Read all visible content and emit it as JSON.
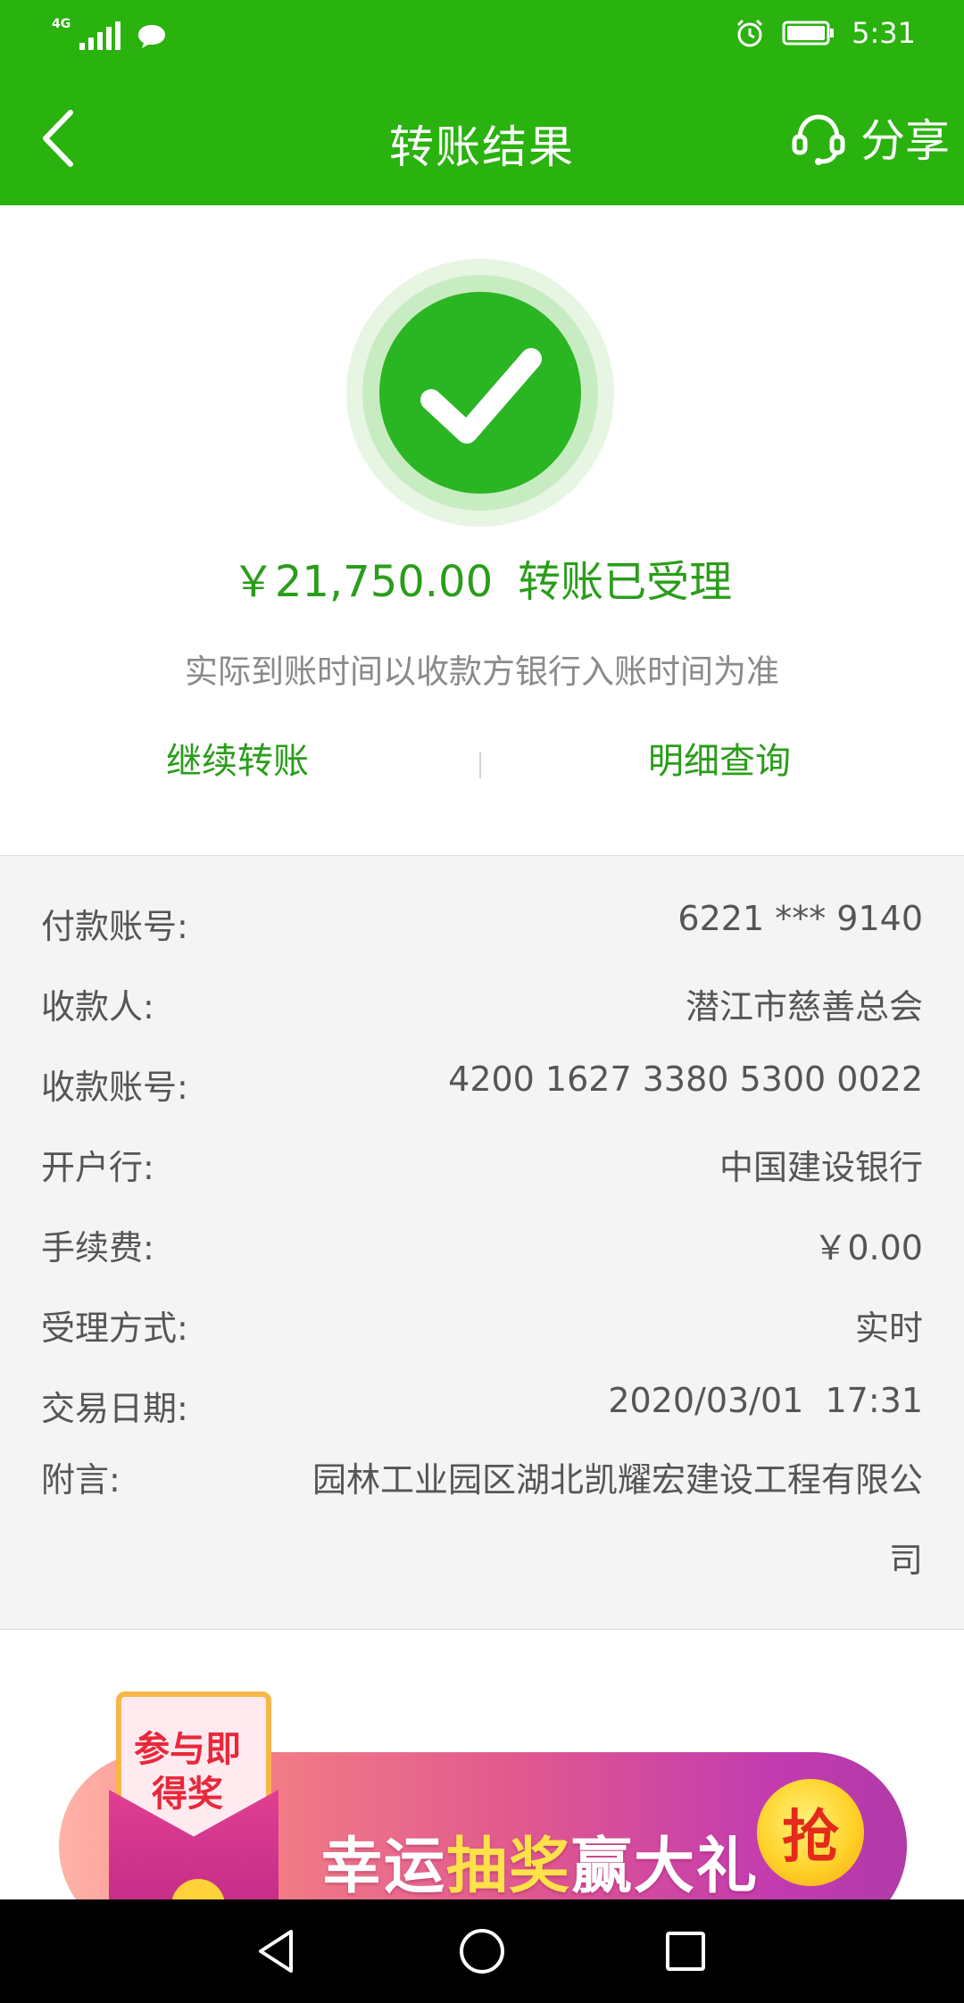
{
  "status_bar": {
    "network_label": "4G",
    "time": "5:31",
    "icons": [
      "signal-icon",
      "message-icon",
      "alarm-icon",
      "battery-icon"
    ]
  },
  "header": {
    "title": "转账结果",
    "share_label": "分享",
    "icons": [
      "back-arrow-icon",
      "customer-service-headset-icon"
    ]
  },
  "result": {
    "icon": "success-check-icon",
    "amount": "￥21,750.00",
    "status": "转账已受理",
    "note": "实际到账时间以收款方银行入账时间为准",
    "actions": {
      "continue_transfer": "继续转账",
      "detail_query": "明细查询"
    }
  },
  "details": {
    "rows": [
      {
        "label": "付款账号:",
        "value": "6221 *** 9140"
      },
      {
        "label": "收款人:",
        "value": "潜江市慈善总会"
      },
      {
        "label": "收款账号:",
        "value": "4200 1627 3380 5300 0022"
      },
      {
        "label": "开户行:",
        "value": "中国建设银行"
      },
      {
        "label": "手续费:",
        "value": "￥0.00"
      },
      {
        "label": "受理方式:",
        "value": "实时"
      },
      {
        "label": "交易日期:",
        "value": "2020/03/01  17:31"
      },
      {
        "label": "附言:",
        "value": "园林工业园区湖北凯耀宏建设工程有限公司"
      }
    ]
  },
  "banner": {
    "envelope_text": "参与即得奖",
    "text_part1": "幸运",
    "text_highlight": "抽奖",
    "text_part2": "赢大礼",
    "button_label": "抢"
  },
  "navbar": {
    "icons": [
      "nav-back-icon",
      "nav-home-icon",
      "nav-recent-icon"
    ]
  },
  "colors": {
    "brand_green": "#2ab20e",
    "action_green": "#2a9d1a",
    "detail_bg": "#f4f4f4"
  }
}
